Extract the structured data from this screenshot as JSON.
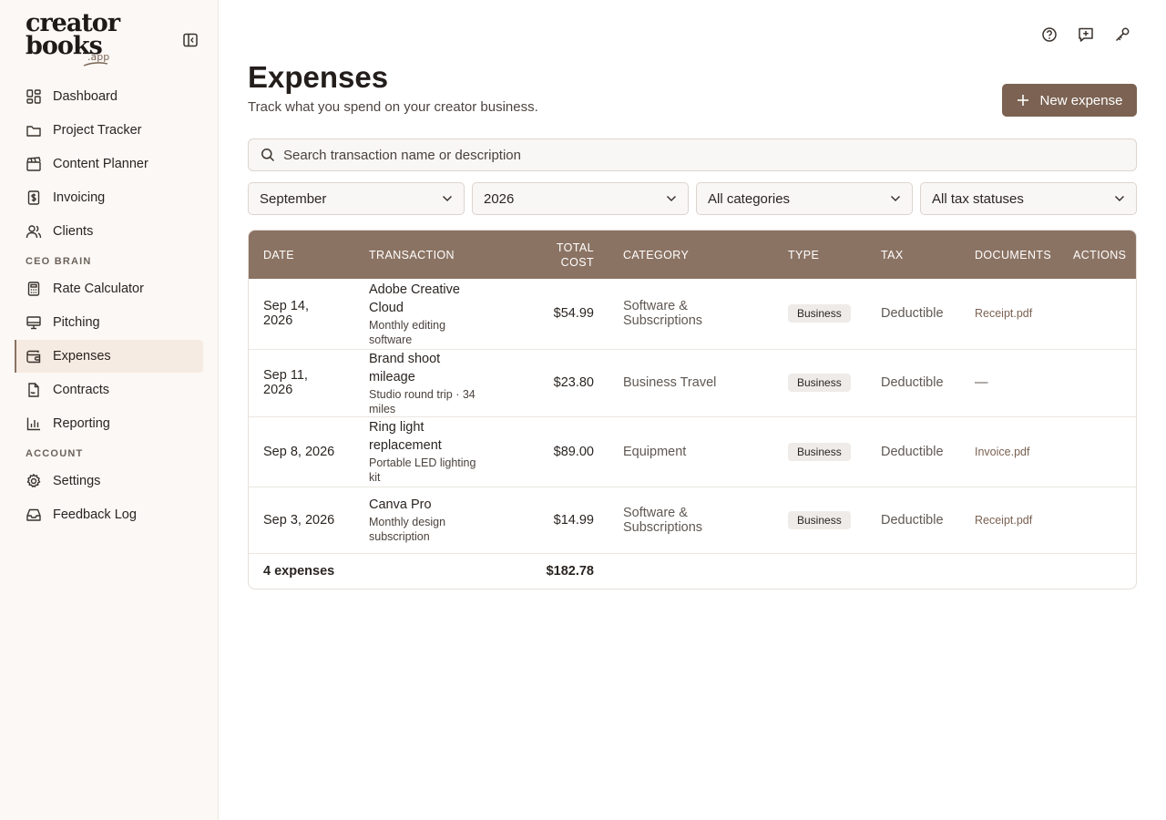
{
  "brand": {
    "line1": "creator",
    "line2": "books",
    "line3": ".app"
  },
  "nav": {
    "items": [
      {
        "label": "Dashboard"
      },
      {
        "label": "Project Tracker"
      },
      {
        "label": "Content Planner"
      },
      {
        "label": "Invoicing"
      },
      {
        "label": "Clients"
      }
    ],
    "section_ceo": "CEO BRAIN",
    "ceo_items": [
      {
        "label": "Rate Calculator"
      },
      {
        "label": "Pitching"
      },
      {
        "label": "Expenses"
      },
      {
        "label": "Contracts"
      },
      {
        "label": "Reporting"
      }
    ],
    "section_account": "ACCOUNT",
    "account_items": [
      {
        "label": "Settings"
      },
      {
        "label": "Feedback Log"
      }
    ],
    "active": "Expenses"
  },
  "page": {
    "title": "Expenses",
    "subtitle": "Track what you spend on your creator business.",
    "new_button": "New expense"
  },
  "search": {
    "placeholder": "Search transaction name or description"
  },
  "filters": {
    "month": "September",
    "year": "2026",
    "category": "All categories",
    "tax_status": "All tax statuses"
  },
  "table": {
    "headers": {
      "date": "DATE",
      "transaction": "TRANSACTION",
      "total_cost_1": "TOTAL",
      "total_cost_2": "COST",
      "category": "CATEGORY",
      "type": "TYPE",
      "tax": "TAX",
      "documents": "DOCUMENTS",
      "actions": "ACTIONS"
    },
    "rows": [
      {
        "date": "Sep 14, 2026",
        "name": "Adobe Creative Cloud",
        "desc": "Monthly editing software",
        "cost": "$54.99",
        "category": "Software & Subscriptions",
        "type": "Business",
        "tax": "Deductible",
        "document": "Receipt.pdf"
      },
      {
        "date": "Sep 11, 2026",
        "name": "Brand shoot mileage",
        "desc": "Studio round trip · 34 miles",
        "cost": "$23.80",
        "category": "Business Travel",
        "type": "Business",
        "tax": "Deductible",
        "document": "—"
      },
      {
        "date": "Sep 8, 2026",
        "name": "Ring light replacement",
        "desc": "Portable LED lighting kit",
        "cost": "$89.00",
        "category": "Equipment",
        "type": "Business",
        "tax": "Deductible",
        "document": "Invoice.pdf"
      },
      {
        "date": "Sep 3, 2026",
        "name": "Canva Pro",
        "desc": "Monthly design subscription",
        "cost": "$14.99",
        "category": "Software & Subscriptions",
        "type": "Business",
        "tax": "Deductible",
        "document": "Receipt.pdf"
      }
    ],
    "footer": {
      "count": "4 expenses",
      "total": "$182.78"
    }
  },
  "icons": {
    "top": [
      "help-circle-icon",
      "message-plus-icon",
      "key-icon"
    ],
    "collapse": "sidebar-collapse-icon"
  },
  "colors": {
    "accent": "#7b6252",
    "header_bg": "#8b7363",
    "sidebar_bg": "#fbf8f5"
  }
}
